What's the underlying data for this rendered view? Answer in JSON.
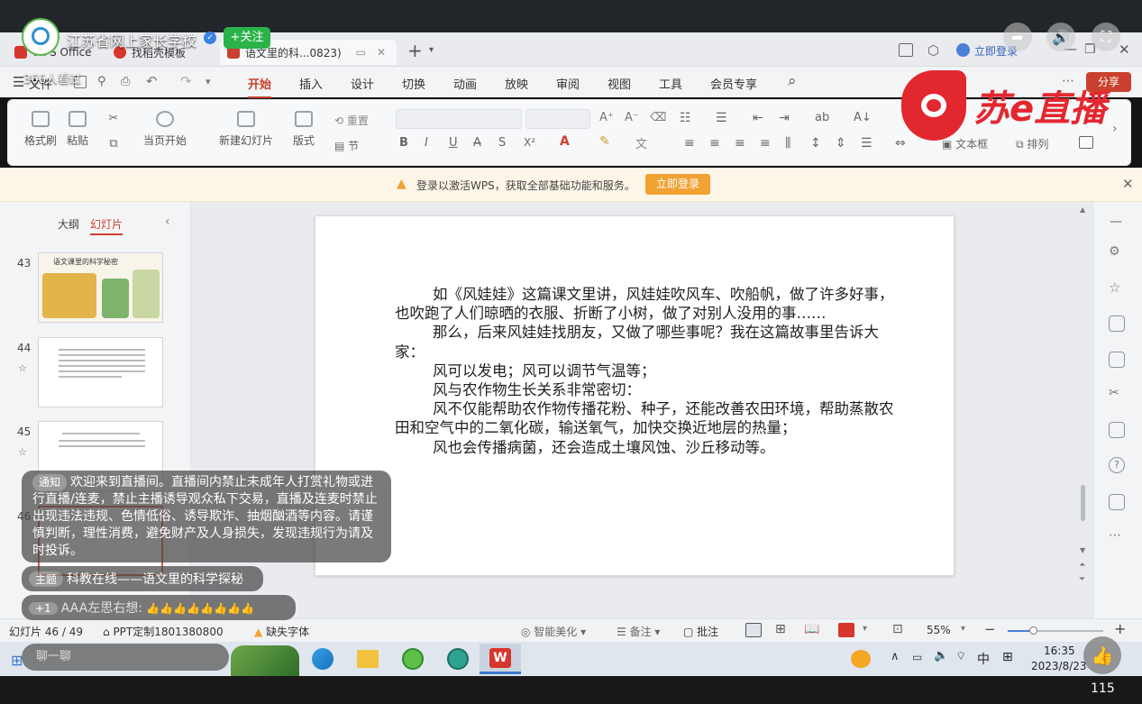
{
  "stream": {
    "channel_name": "江苏省网上家长学校",
    "follow_label": "+关注",
    "viewers": "366人看过",
    "brand_logo_text": "苏e直播",
    "chat_placeholder": "聊一聊",
    "like_count": "115"
  },
  "wps": {
    "tabs": [
      {
        "label": "WPS Office"
      },
      {
        "label": "找稻壳模板"
      },
      {
        "label": "语文里的科...0823)"
      }
    ],
    "login_label": "立即登录",
    "share_label": "分享",
    "menus": [
      "文件",
      "开始",
      "插入",
      "设计",
      "切换",
      "动画",
      "放映",
      "审阅",
      "视图",
      "工具",
      "会员专享"
    ],
    "active_menu": "开始",
    "ribbon": {
      "format_painter": "格式刷",
      "paste": "粘贴",
      "play_current": "当页开始",
      "new_slide": "新建幻灯片",
      "layout": "版式",
      "reset": "重置",
      "section": "节",
      "textbox": "文本框",
      "arrange": "排列",
      "shape": "形状"
    },
    "notice": {
      "text": "登录以激活WPS，获取全部基础功能和服务。",
      "button": "立即登录"
    },
    "left_tabs": [
      "大纲",
      "幻灯片"
    ],
    "thumbnails": [
      {
        "num": "43",
        "title": "语文课里的科学秘密"
      },
      {
        "num": "44"
      },
      {
        "num": "45"
      },
      {
        "num": "46"
      }
    ],
    "slide_paragraphs": [
      "        如《风娃娃》这篇课文里讲，风娃娃吹风车、吹船帆，做了许多好事，也吹跑了人们晾晒的衣服、折断了小树，做了对别人没用的事……",
      "        那么，后来风娃娃找朋友，又做了哪些事呢？我在这篇故事里告诉大家：",
      "        风可以发电；风可以调节气温等；",
      "        风与农作物生长关系非常密切：",
      "        风不仅能帮助农作物传播花粉、种子，还能改善农田环境，帮助蒸散农田和空气中的二氧化碳，输送氧气，加快交换近地层的热量；",
      "        风也会传播病菌，还会造成土壤风蚀、沙丘移动等。"
    ],
    "status": {
      "slide_counter": "幻灯片 46 / 49",
      "ppt_custom": "PPT定制1801380800",
      "missing_font": "缺失字体",
      "beautify": "智能美化",
      "notes": "备注",
      "comment": "批注",
      "zoom": "55%"
    }
  },
  "chat": {
    "notice_tag": "通知",
    "notice_text": "欢迎来到直播间。直播间内禁止未成年人打赏礼物或进行直播/连麦，禁止主播诱导观众私下交易，直播及连麦时禁止出现违法违规、色情低俗、诱导欺诈、抽烟酗酒等内容。请谨慎判断，理性消费，避免财产及人身损失，发现违规行为请及时投诉。",
    "topic_tag": "主题",
    "topic_text": "科教在线——语文里的科学探秘",
    "message_tag": "+1",
    "message_user": "AAA左思右想:",
    "message_text": "👍👍👍👍👍👍👍👍"
  },
  "taskbar": {
    "time": "16:35",
    "date": "2023/8/23",
    "ime": "中"
  },
  "colors": {
    "accent_red": "#c9412e",
    "follow_green": "#2bb34a",
    "login_orange": "#f0a233",
    "brand_red": "#e3272f"
  }
}
